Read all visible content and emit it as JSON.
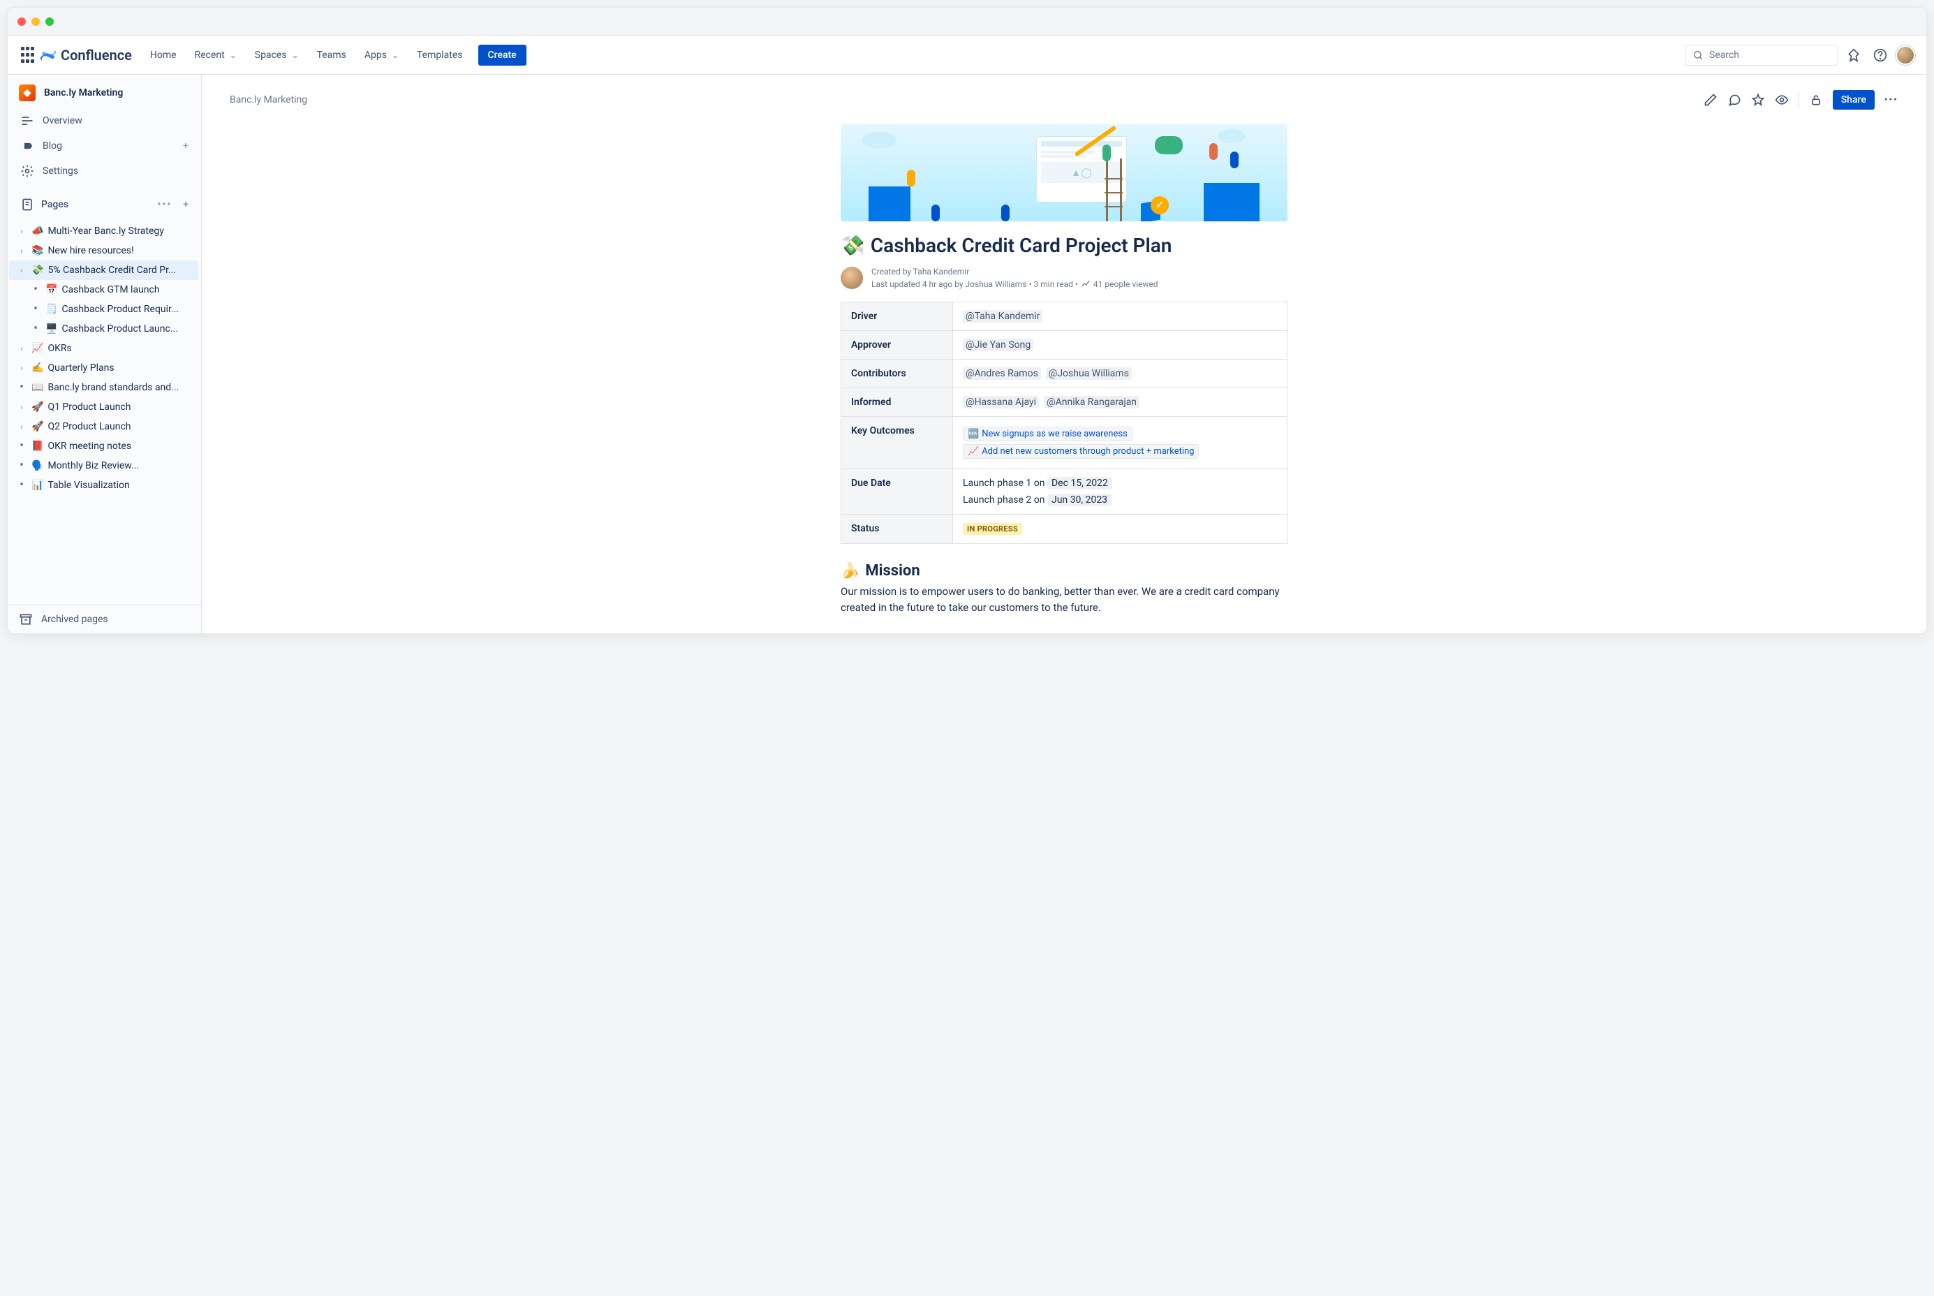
{
  "app": {
    "name": "Confluence"
  },
  "nav": {
    "home": "Home",
    "recent": "Recent",
    "spaces": "Spaces",
    "teams": "Teams",
    "apps": "Apps",
    "templates": "Templates",
    "create": "Create",
    "search_placeholder": "Search"
  },
  "space": {
    "name": "Banc.ly Marketing"
  },
  "sidebar": {
    "overview": "Overview",
    "blog": "Blog",
    "settings": "Settings",
    "pages": "Pages",
    "archived": "Archived pages",
    "tree": [
      {
        "chev": true,
        "emoji": "📣",
        "label": "Multi-Year Banc.ly Strategy"
      },
      {
        "chev": true,
        "emoji": "📚",
        "label": "New hire resources!"
      },
      {
        "chev": true,
        "emoji": "💸",
        "label": "5% Cashback Credit Card Pr...",
        "selected": true
      },
      {
        "chev": false,
        "l2": true,
        "emoji": "📅",
        "label": "Cashback GTM launch"
      },
      {
        "chev": false,
        "l2": true,
        "emoji": "🗒️",
        "label": "Cashback Product Requir..."
      },
      {
        "chev": false,
        "l2": true,
        "emoji": "🖥️",
        "label": "Cashback Product Launc..."
      },
      {
        "chev": true,
        "emoji": "📈",
        "label": "OKRs"
      },
      {
        "chev": true,
        "emoji": "✍️",
        "label": "Quarterly Plans"
      },
      {
        "chev": false,
        "emoji": "📖",
        "label": "Banc.ly brand standards and..."
      },
      {
        "chev": true,
        "emoji": "🚀",
        "label": "Q1 Product Launch"
      },
      {
        "chev": true,
        "emoji": "🚀",
        "label": "Q2 Product Launch"
      },
      {
        "chev": false,
        "emoji": "📕",
        "label": "OKR meeting notes"
      },
      {
        "chev": false,
        "emoji": "🗣️",
        "label": "Monthly Biz Review..."
      },
      {
        "chev": false,
        "emoji": "📊",
        "label": "Table Visualization"
      }
    ]
  },
  "page": {
    "breadcrumb": "Banc.ly Marketing",
    "share": "Share",
    "title_emoji": "💸",
    "title": "Cashback Credit Card Project Plan",
    "created_by_label": "Created by ",
    "created_by": "Taha Kandemir",
    "updated": "Last updated 4 hr ago by Joshua Williams",
    "read": "3 min read",
    "viewed": "41 people viewed",
    "meta": {
      "driver_label": "Driver",
      "driver": "@Taha Kandemir",
      "approver_label": "Approver",
      "approver": "@Jie Yan Song",
      "contrib_label": "Contributors",
      "contrib1": "@Andres Ramos",
      "contrib2": "@Joshua Williams",
      "informed_label": "Informed",
      "informed1": "@Hassana Ajayi",
      "informed2": "@Annika Rangarajan",
      "outcomes_label": "Key Outcomes",
      "outcome1_emoji": "🆕",
      "outcome1": "New signups as we raise awareness",
      "outcome2_emoji": "📈",
      "outcome2": "Add net new customers through product + marketing",
      "due_label": "Due Date",
      "due1_pre": "Launch phase 1 on ",
      "due1": "Dec 15, 2022",
      "due2_pre": "Launch phase 2 on ",
      "due2": "Jun 30, 2023",
      "status_label": "Status",
      "status": "IN PROGRESS"
    },
    "mission_emoji": "🍌",
    "mission_title": "Mission",
    "mission_body": "Our mission is to empower users to do banking, better than ever. We are a credit card company created in the future to take our customers to the future."
  }
}
